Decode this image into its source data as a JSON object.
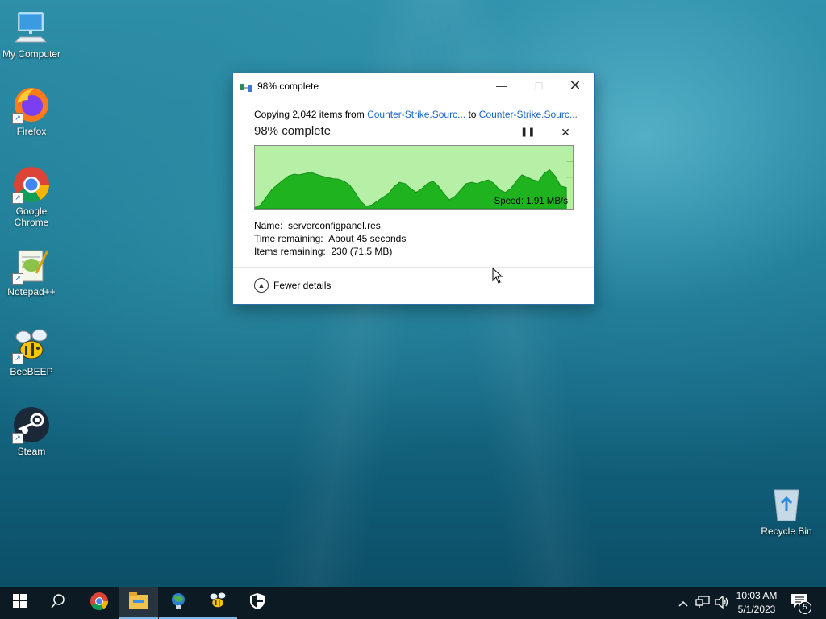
{
  "desktop": {
    "icons": [
      {
        "label": "My Computer",
        "icon": "computer-icon"
      },
      {
        "label": "Firefox",
        "icon": "firefox-icon"
      },
      {
        "label": "Google Chrome",
        "icon": "chrome-icon"
      },
      {
        "label": "Notepad++",
        "icon": "notepadpp-icon"
      },
      {
        "label": "BeeBEEP",
        "icon": "beebeep-icon"
      },
      {
        "label": "Steam",
        "icon": "steam-icon"
      },
      {
        "label": "Recycle Bin",
        "icon": "recycle-bin-icon"
      }
    ]
  },
  "dialog": {
    "title": "98% complete",
    "copy_prefix": "Copying 2,042 items from ",
    "source_link": "Counter-Strike.Sourc...",
    "copy_middle": " to ",
    "dest_link": "Counter-Strike.Sourc...",
    "big_status": "98% complete",
    "progress_percent": 98,
    "speed": "Speed: 1.91 MB/s",
    "name_label": "Name:",
    "name_value": "serverconfigpanel.res",
    "time_label": "Time remaining:",
    "time_value": "About 45 seconds",
    "items_label": "Items remaining:",
    "items_value": "230 (71.5 MB)",
    "fewer_details": "Fewer details",
    "graph_color": "#1fb31f",
    "graph_bg": "#b6f0a6"
  },
  "taskbar": {
    "apps": [
      "windows-start-icon",
      "search-icon",
      "chrome-icon",
      "file-explorer-icon",
      "network-app-icon",
      "beebeep-icon",
      "security-shield-icon"
    ],
    "clock_time": "10:03 AM",
    "clock_date": "5/1/2023",
    "notification_count": "5"
  }
}
